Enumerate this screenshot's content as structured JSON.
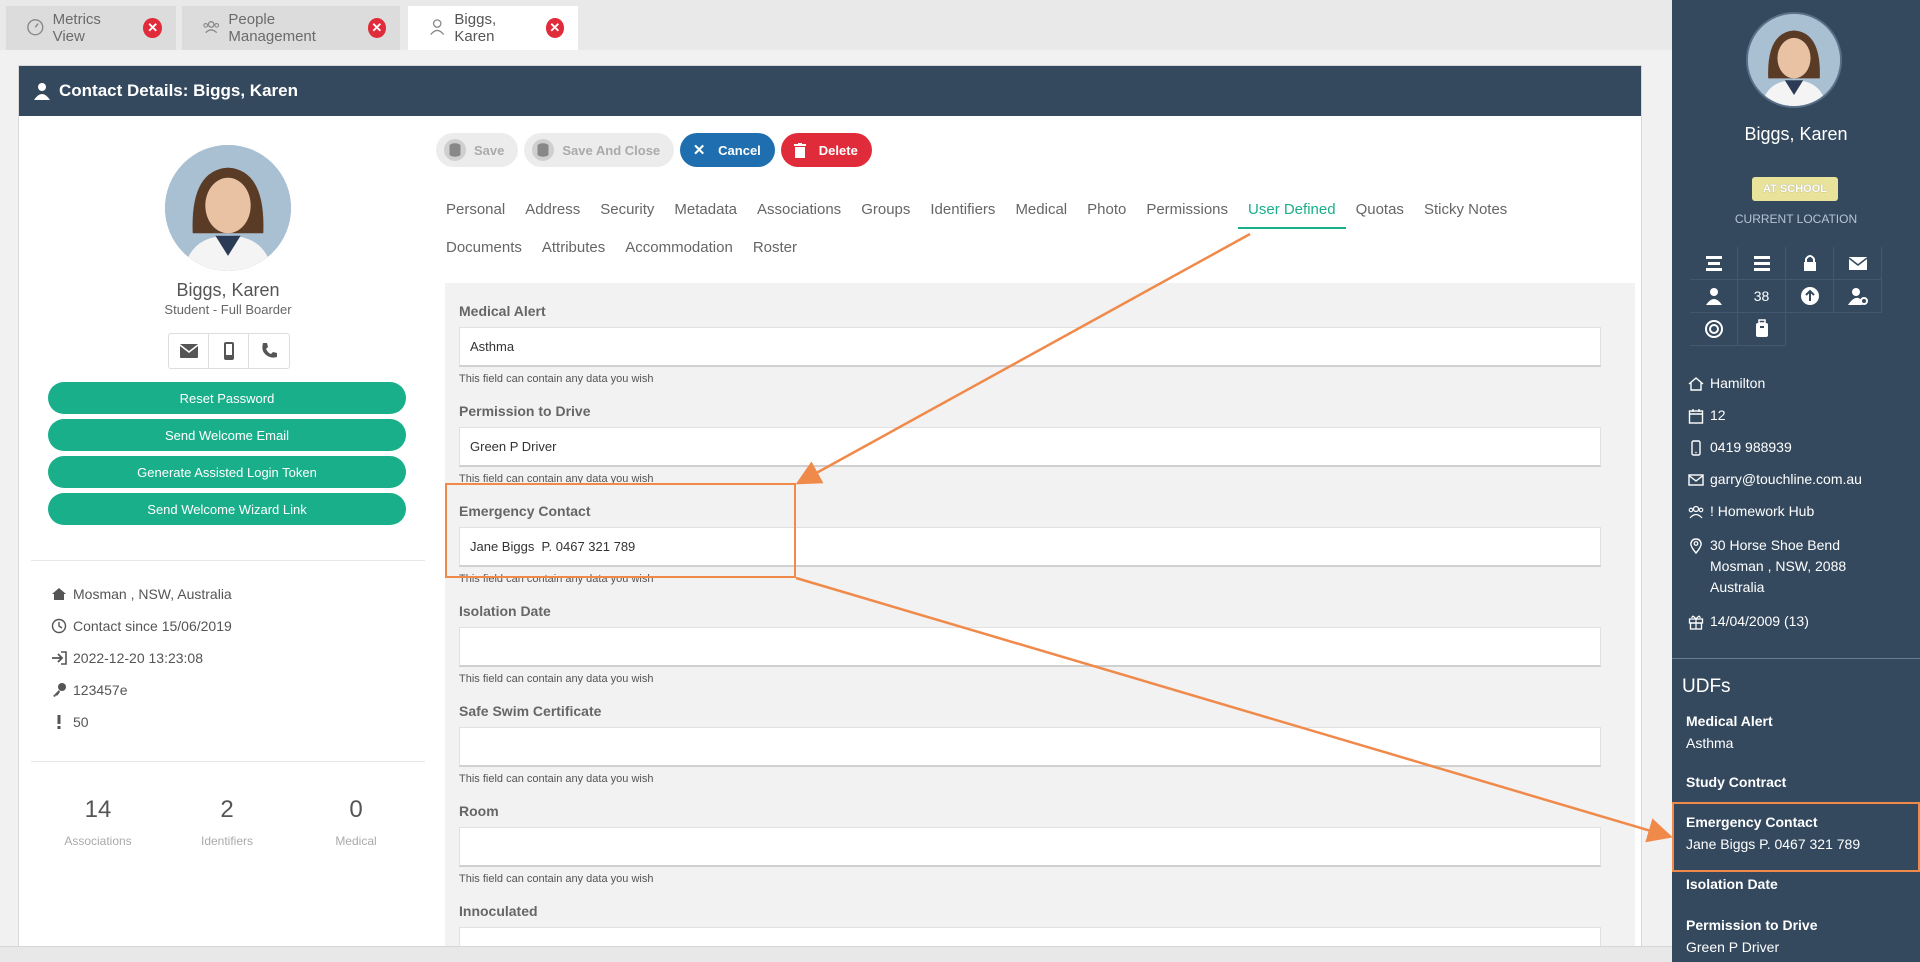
{
  "tabs": [
    {
      "label": "Metrics View",
      "icon": "gauge-icon"
    },
    {
      "label": "People Management",
      "icon": "people-icon"
    },
    {
      "label": "Biggs, Karen",
      "icon": "user-icon",
      "active": true
    }
  ],
  "panel": {
    "title": "Contact Details: Biggs, Karen"
  },
  "profile": {
    "name": "Biggs, Karen",
    "role": "Student - Full Boarder",
    "actions": [
      "Reset Password",
      "Send Welcome Email",
      "Generate Assisted Login Token",
      "Send Welcome Wizard Link"
    ],
    "info": [
      {
        "icon": "home-icon",
        "text": "Mosman , NSW, Australia"
      },
      {
        "icon": "clock-icon",
        "text": "Contact since 15/06/2019"
      },
      {
        "icon": "login-icon",
        "text": "2022-12-20 13:23:08"
      },
      {
        "icon": "key-icon",
        "text": "123457e"
      },
      {
        "icon": "exclamation-icon",
        "text": "50"
      }
    ],
    "stats": [
      {
        "num": "14",
        "label": "Associations"
      },
      {
        "num": "2",
        "label": "Identifiers"
      },
      {
        "num": "0",
        "label": "Medical"
      }
    ]
  },
  "toolbar": {
    "save": "Save",
    "save_close": "Save And Close",
    "cancel": "Cancel",
    "delete": "Delete"
  },
  "subtabs": {
    "row1": [
      "Personal",
      "Address",
      "Security",
      "Metadata",
      "Associations",
      "Groups",
      "Identifiers",
      "Medical",
      "Photo",
      "Permissions",
      "User Defined",
      "Quotas",
      "Sticky Notes"
    ],
    "row2": [
      "Documents",
      "Attributes",
      "Accommodation",
      "Roster"
    ],
    "active": "User Defined"
  },
  "fields": [
    {
      "label": "Medical Alert",
      "value": "Asthma",
      "help": "This field can contain any data you wish"
    },
    {
      "label": "Permission to Drive",
      "value": "Green P Driver",
      "help": "This field can contain any data you wish"
    },
    {
      "label": "Emergency Contact",
      "value": "Jane Biggs  P. 0467 321 789",
      "help": "This field can contain any data you wish"
    },
    {
      "label": "Isolation Date",
      "value": "",
      "help": "This field can contain any data you wish"
    },
    {
      "label": "Safe Swim Certificate",
      "value": "",
      "help": "This field can contain any data you wish"
    },
    {
      "label": "Room",
      "value": "",
      "help": "This field can contain any data you wish"
    },
    {
      "label": "Innoculated",
      "value": "",
      "help": ""
    }
  ],
  "sidebar": {
    "name": "Biggs, Karen",
    "location_badge": "AT SCHOOL",
    "location_label": "CURRENT LOCATION",
    "grid_count": "38",
    "info": [
      {
        "icon": "home-icon",
        "text": "Hamilton"
      },
      {
        "icon": "calendar-icon",
        "text": "12"
      },
      {
        "icon": "mobile-icon",
        "text": "0419 988939"
      },
      {
        "icon": "envelope-icon",
        "text": "garry@touchline.com.au"
      },
      {
        "icon": "group-icon",
        "text": "! Homework Hub"
      },
      {
        "icon": "map-pin-icon",
        "text": "30 Horse Shoe Bend",
        "line2": "Mosman , NSW, 2088",
        "line3": "Australia"
      },
      {
        "icon": "gift-icon",
        "text": "14/04/2009 (13)"
      }
    ],
    "udf_title": "UDFs",
    "udfs": [
      {
        "label": "Medical Alert",
        "value": "Asthma"
      },
      {
        "label": "Study Contract",
        "value": ""
      },
      {
        "label": "Emergency Contact",
        "value": "Jane Biggs P. 0467 321 789"
      },
      {
        "label": "Isolation Date",
        "value": ""
      },
      {
        "label": "Permission to Drive",
        "value": "Green P Driver"
      }
    ]
  },
  "colors": {
    "header": "#34495e",
    "green": "#1aaf8b",
    "blue": "#1f6fb0",
    "red": "#e02b3b",
    "annotation": "#f08a4b"
  }
}
